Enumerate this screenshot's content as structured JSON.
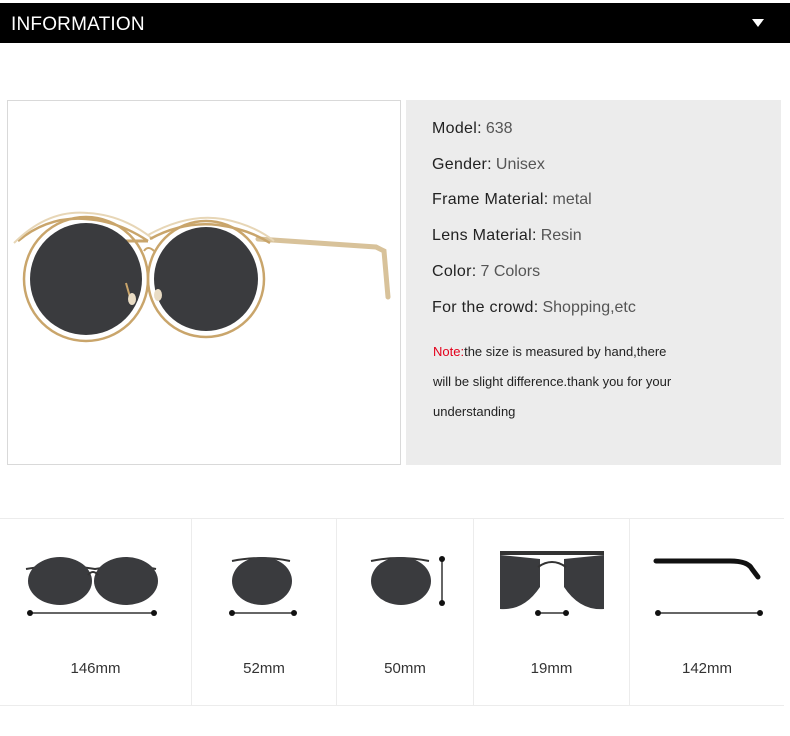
{
  "header": {
    "title": "INFORMATION",
    "icon": "caret-down-icon"
  },
  "specs": [
    {
      "key": "Model:",
      "value": "638"
    },
    {
      "key": "Gender:",
      "value": "Unisex"
    },
    {
      "key": "Frame Material:",
      "value": "metal"
    },
    {
      "key": "Lens Material:",
      "value": "Resin"
    },
    {
      "key": "Color:",
      "value": "7 Colors"
    },
    {
      "key": "For the crowd:",
      "value": "Shopping,etc"
    }
  ],
  "note": {
    "label": "Note:",
    "line1": "the size is measured by hand,there",
    "line2": "will be slight difference.thank you for your",
    "line3": "understanding"
  },
  "measurements": [
    {
      "label": "146mm"
    },
    {
      "label": "52mm"
    },
    {
      "label": "50mm"
    },
    {
      "label": "19mm"
    },
    {
      "label": "142mm"
    }
  ],
  "colors": {
    "header_bg": "#000000",
    "note_label": "#e3001b",
    "panel_bg": "#ececec",
    "lens": "#3a3b3e",
    "frame": "#c9a56b"
  }
}
